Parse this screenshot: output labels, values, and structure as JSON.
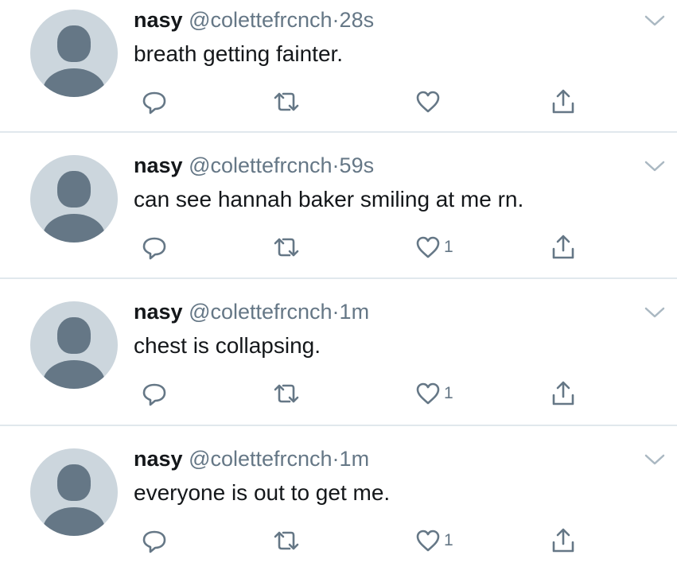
{
  "tweets": [
    {
      "name": "nasy",
      "handle": "@colettefrcnch",
      "separator": "·",
      "time": "28s",
      "text": "breath getting fainter.",
      "like_count": ""
    },
    {
      "name": "nasy",
      "handle": "@colettefrcnch",
      "separator": "·",
      "time": "59s",
      "text": "can see hannah baker smiling at me rn.",
      "like_count": "1"
    },
    {
      "name": "nasy",
      "handle": "@colettefrcnch",
      "separator": "·",
      "time": "1m",
      "text": "chest is collapsing.",
      "like_count": "1"
    },
    {
      "name": "nasy",
      "handle": "@colettefrcnch",
      "separator": "·",
      "time": "1m",
      "text": "everyone is out to get me.",
      "like_count": "1"
    }
  ],
  "icons": {
    "avatar": "default-profile-icon",
    "menu": "chevron-down-icon",
    "reply": "reply-icon",
    "retweet": "retweet-icon",
    "like": "heart-icon",
    "share": "share-icon"
  },
  "colors": {
    "text": "#14171a",
    "secondary": "#657786",
    "avatar_bg": "#ccd6dd",
    "divider": "#e1e8ed"
  }
}
